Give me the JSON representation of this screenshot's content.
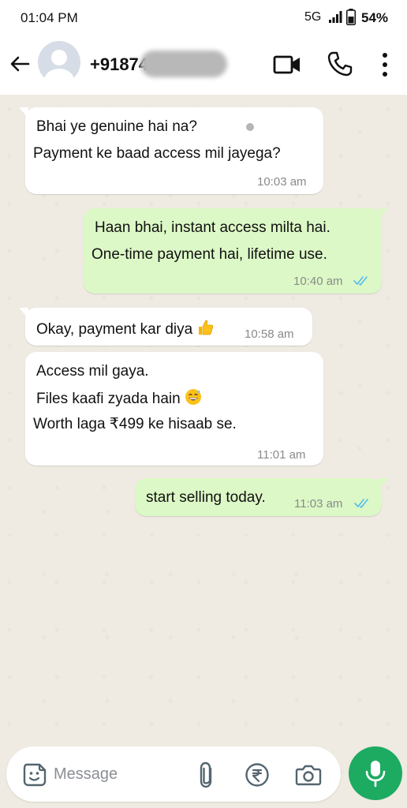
{
  "status_bar": {
    "time": "01:04 PM",
    "network": "5G",
    "battery": "54%",
    "icons": [
      "signal-icon",
      "battery-icon"
    ]
  },
  "header": {
    "contact_name": "+91874",
    "icons": [
      "back-arrow-icon",
      "avatar-placeholder",
      "video-call-icon",
      "voice-call-icon",
      "more-options-icon"
    ]
  },
  "messages": [
    {
      "direction": "in",
      "lines": [
        "Bhai ye genuine hai na?",
        "Payment ke baad access mil jayega?"
      ],
      "time": "10:03 am"
    },
    {
      "direction": "out",
      "lines": [
        "Haan bhai, instant access milta hai.",
        "One-time payment hai, lifetime use."
      ],
      "time": "10:40 am",
      "read": true
    },
    {
      "direction": "in",
      "lines": [
        "Okay, payment kar diya"
      ],
      "emoji": "thumbs-up",
      "time": "10:58 am"
    },
    {
      "direction": "in",
      "lines": [
        "Access mil gaya.",
        "Files kaafi zyada hain",
        "Worth laga ₹499 ke hisaab se."
      ],
      "emoji": "grinning-sweat",
      "time": "11:01 am"
    },
    {
      "direction": "out",
      "lines": [
        "start selling today."
      ],
      "time": "11:03 am",
      "read": true
    }
  ],
  "input": {
    "placeholder": "Message",
    "icons": [
      "sticker-icon",
      "attach-icon",
      "rupee-payment-icon",
      "camera-icon",
      "mic-icon"
    ]
  },
  "colors": {
    "chat_background": "#efeae2",
    "incoming_bubble": "#ffffff",
    "outgoing_bubble": "#dcf8c6",
    "read_ticks": "#53bdeb",
    "mic_button": "#1daa61"
  }
}
